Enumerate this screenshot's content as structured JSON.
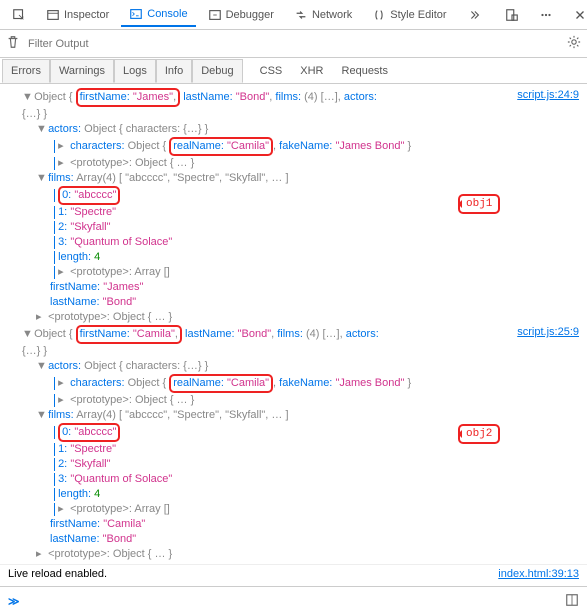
{
  "toolbar": {
    "inspector": "Inspector",
    "console": "Console",
    "debugger": "Debugger",
    "network": "Network",
    "styleeditor": "Style Editor"
  },
  "filter": {
    "placeholder": "Filter Output"
  },
  "tabs": {
    "errors": "Errors",
    "warnings": "Warnings",
    "logs": "Logs",
    "info": "Info",
    "debug": "Debug",
    "css": "CSS",
    "xhr": "XHR",
    "requests": "Requests"
  },
  "obj1": {
    "source": "script.js:24:9",
    "header_fn_k": "firstName:",
    "header_fn_v": "\"James\"",
    "header_ln_k": "lastName:",
    "header_ln_v": "\"Bond\"",
    "header_films_k": "films:",
    "header_films_n": "(4)",
    "header_arr": "[…]",
    "header_actors_k": "actors:",
    "actors_hdr": "Object { characters: {…} }",
    "char_hdr_pre": "Object { ",
    "char_rn_k": "realName:",
    "char_rn_v": "\"Camila\"",
    "char_fn_k": "fakeName:",
    "char_fn_v": "\"James Bond\"",
    "char_hdr_post": " }",
    "proto_obj": "Object { … }",
    "films_hdr_pre": "Array(4)",
    "films_hdr_arr": "[ \"abcccc\", \"Spectre\", \"Skyfall\", … ]",
    "f0_k": "0:",
    "f0_v": "\"abcccc\"",
    "f1_k": "1:",
    "f1_v": "\"Spectre\"",
    "f2_k": "2:",
    "f2_v": "\"Skyfall\"",
    "f3_k": "3:",
    "f3_v": "\"Quantum of Solace\"",
    "len_k": "length:",
    "len_v": "4",
    "proto_arr": "Array []",
    "fn_k": "firstName:",
    "fn_v": "\"James\"",
    "ln_k": "lastName:",
    "ln_v": "\"Bond\""
  },
  "obj2": {
    "source": "script.js:25:9",
    "header_fn_k": "firstName:",
    "header_fn_v": "\"Camila\"",
    "header_ln_k": "lastName:",
    "header_ln_v": "\"Bond\"",
    "header_films_k": "films:",
    "header_films_n": "(4)",
    "header_arr": "[…]",
    "header_actors_k": "actors:",
    "actors_hdr": "Object { characters: {…} }",
    "char_hdr_pre": "Object { ",
    "char_rn_k": "realName:",
    "char_rn_v": "\"Camila\"",
    "char_fn_k": "fakeName:",
    "char_fn_v": "\"James Bond\"",
    "char_hdr_post": " }",
    "proto_obj": "Object { … }",
    "films_hdr_pre": "Array(4)",
    "films_hdr_arr": "[ \"abcccc\", \"Spectre\", \"Skyfall\", … ]",
    "f0_k": "0:",
    "f0_v": "\"abcccc\"",
    "f1_k": "1:",
    "f1_v": "\"Spectre\"",
    "f2_k": "2:",
    "f2_v": "\"Skyfall\"",
    "f3_k": "3:",
    "f3_v": "\"Quantum of Solace\"",
    "len_k": "length:",
    "len_v": "4",
    "proto_arr": "Array []",
    "fn_k": "firstName:",
    "fn_v": "\"Camila\"",
    "ln_k": "lastName:",
    "ln_v": "\"Bond\""
  },
  "labels": {
    "object": "Object",
    "actors_k": "actors:",
    "characters_k": "characters:",
    "films_k": "films:",
    "proto_k": "<prototype>:",
    "brace_open": "{ ",
    "brace_hellip": "{…} }",
    "comma": ", ",
    "comma2": ","
  },
  "callouts": {
    "obj1": "obj1",
    "obj2": "obj2"
  },
  "footer": {
    "msg": "Live reload enabled.",
    "source": "index.html:39:13"
  }
}
